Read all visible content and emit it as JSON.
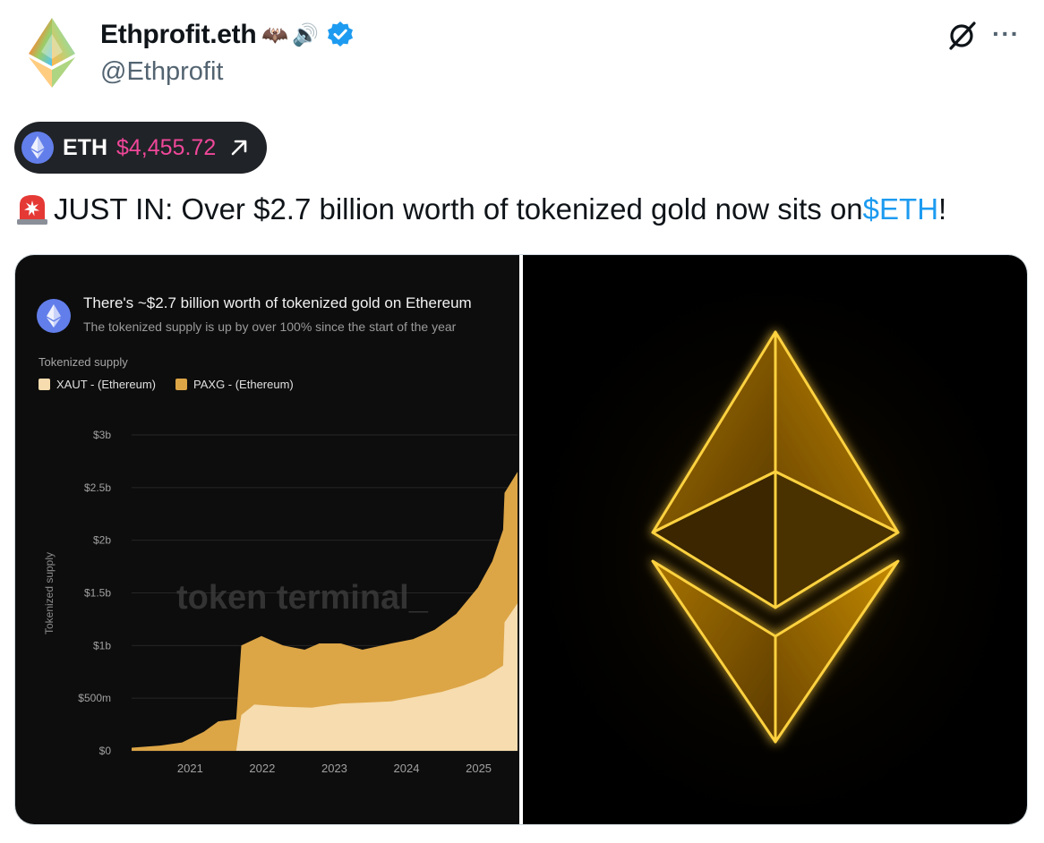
{
  "author": {
    "name": "Ethprofit.eth",
    "name_emoji_1": "🦇",
    "name_emoji_2": "🔊",
    "handle": "@Ethprofit",
    "avatar_icon": "ethereum-diamond-rainbow-icon",
    "verified_badge": "verified-badge-icon"
  },
  "header_actions": {
    "grok_icon": "grok-icon",
    "more_label": "···"
  },
  "ticker": {
    "symbol": "ETH",
    "price": "$4,455.72",
    "arrow_icon": "arrow-up-right-icon"
  },
  "tweet": {
    "siren": "🚨",
    "text_before": "JUST IN: Over $2.7 billion worth of tokenized gold now sits on ",
    "cashtag": "$ETH",
    "text_after": "!"
  },
  "chart_data": {
    "type": "area",
    "title": "There's ~$2.7 billion worth of tokenized gold on Ethereum",
    "subtitle": "The tokenized supply is up by over 100% since the start of the year",
    "caption": "Tokenized supply",
    "ylabel": "Tokenized supply",
    "watermark": "token terminal_",
    "y_ticks": [
      "$0",
      "$500m",
      "$1b",
      "$1.5b",
      "$2b",
      "$2.5b",
      "$3b"
    ],
    "x_ticks": [
      "2021",
      "2022",
      "2023",
      "2024",
      "2025"
    ],
    "ylim": [
      0,
      3000
    ],
    "stacked": true,
    "series": [
      {
        "name": "XAUT - (Ethereum)",
        "color": "#f6dcae",
        "points": [
          [
            2020.4,
            0
          ],
          [
            2021.85,
            0
          ],
          [
            2021.92,
            340
          ],
          [
            2022.1,
            440
          ],
          [
            2022.5,
            420
          ],
          [
            2022.9,
            410
          ],
          [
            2023.3,
            450
          ],
          [
            2023.7,
            460
          ],
          [
            2024.0,
            470
          ],
          [
            2024.4,
            520
          ],
          [
            2024.7,
            560
          ],
          [
            2025.0,
            620
          ],
          [
            2025.3,
            700
          ],
          [
            2025.55,
            810
          ],
          [
            2025.57,
            1220
          ],
          [
            2025.75,
            1400
          ]
        ]
      },
      {
        "name": "PAXG - (Ethereum)",
        "color": "#dca546",
        "points": [
          [
            2020.4,
            30
          ],
          [
            2020.8,
            50
          ],
          [
            2021.1,
            80
          ],
          [
            2021.4,
            180
          ],
          [
            2021.6,
            280
          ],
          [
            2021.85,
            300
          ],
          [
            2021.92,
            1000
          ],
          [
            2022.2,
            1090
          ],
          [
            2022.5,
            1000
          ],
          [
            2022.8,
            960
          ],
          [
            2023.0,
            1020
          ],
          [
            2023.3,
            1020
          ],
          [
            2023.6,
            960
          ],
          [
            2024.0,
            1020
          ],
          [
            2024.3,
            1060
          ],
          [
            2024.6,
            1150
          ],
          [
            2024.9,
            1300
          ],
          [
            2025.2,
            1550
          ],
          [
            2025.4,
            1800
          ],
          [
            2025.55,
            2100
          ],
          [
            2025.57,
            2450
          ],
          [
            2025.75,
            2650
          ]
        ]
      }
    ]
  },
  "media_right": {
    "description_icon": "ethereum-glowing-gold-logo-icon"
  }
}
